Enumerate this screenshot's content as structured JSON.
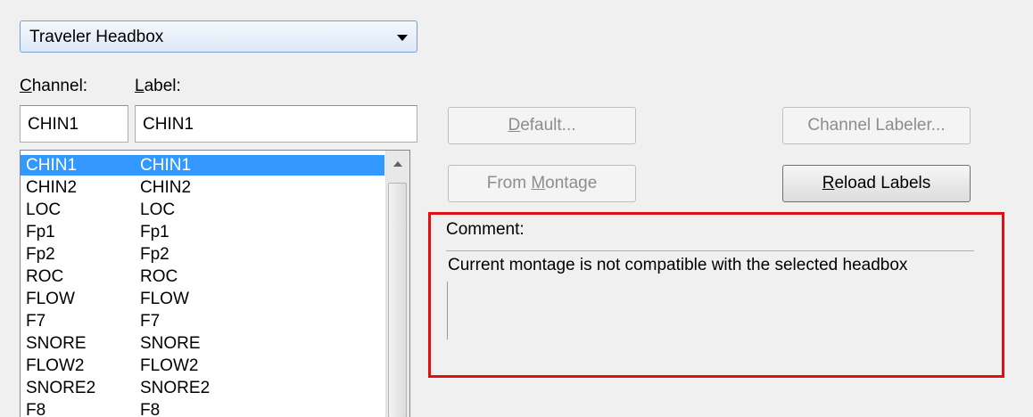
{
  "headbox": {
    "selected": "Traveler Headbox",
    "icon": "dropdown-arrow-icon"
  },
  "channel_header": {
    "channel": "Channel:",
    "channel_mnemonic": "C",
    "channel_rest": "hannel:",
    "label_mnemonic": "L",
    "label_rest": "abel:"
  },
  "channel_input": {
    "value": "CHIN1"
  },
  "label_input": {
    "value": "CHIN1"
  },
  "channels": [
    {
      "channel": "CHIN1",
      "label": "CHIN1",
      "selected": true
    },
    {
      "channel": "CHIN2",
      "label": "CHIN2"
    },
    {
      "channel": "LOC",
      "label": "LOC"
    },
    {
      "channel": "Fp1",
      "label": "Fp1"
    },
    {
      "channel": "Fp2",
      "label": "Fp2"
    },
    {
      "channel": "ROC",
      "label": "ROC"
    },
    {
      "channel": "FLOW",
      "label": "FLOW"
    },
    {
      "channel": "F7",
      "label": "F7"
    },
    {
      "channel": "SNORE",
      "label": "SNORE"
    },
    {
      "channel": "FLOW2",
      "label": "FLOW2"
    },
    {
      "channel": "SNORE2",
      "label": "SNORE2"
    },
    {
      "channel": "F8",
      "label": "F8"
    }
  ],
  "buttons": {
    "default": {
      "mnemonic": "D",
      "rest": "efault...",
      "enabled": false
    },
    "channel_labeler": {
      "text": "Channel Labeler...",
      "enabled": false
    },
    "from_montage": {
      "before": "From ",
      "mnemonic": "M",
      "rest": "ontage",
      "enabled": false
    },
    "reload_labels": {
      "mnemonic": "R",
      "rest": "eload Labels",
      "enabled": true
    }
  },
  "comment": {
    "label": "Comment:",
    "text": "Current montage is not compatible with the selected headbox"
  },
  "colors": {
    "highlight": "#e01010",
    "selection": "#3399ff"
  }
}
